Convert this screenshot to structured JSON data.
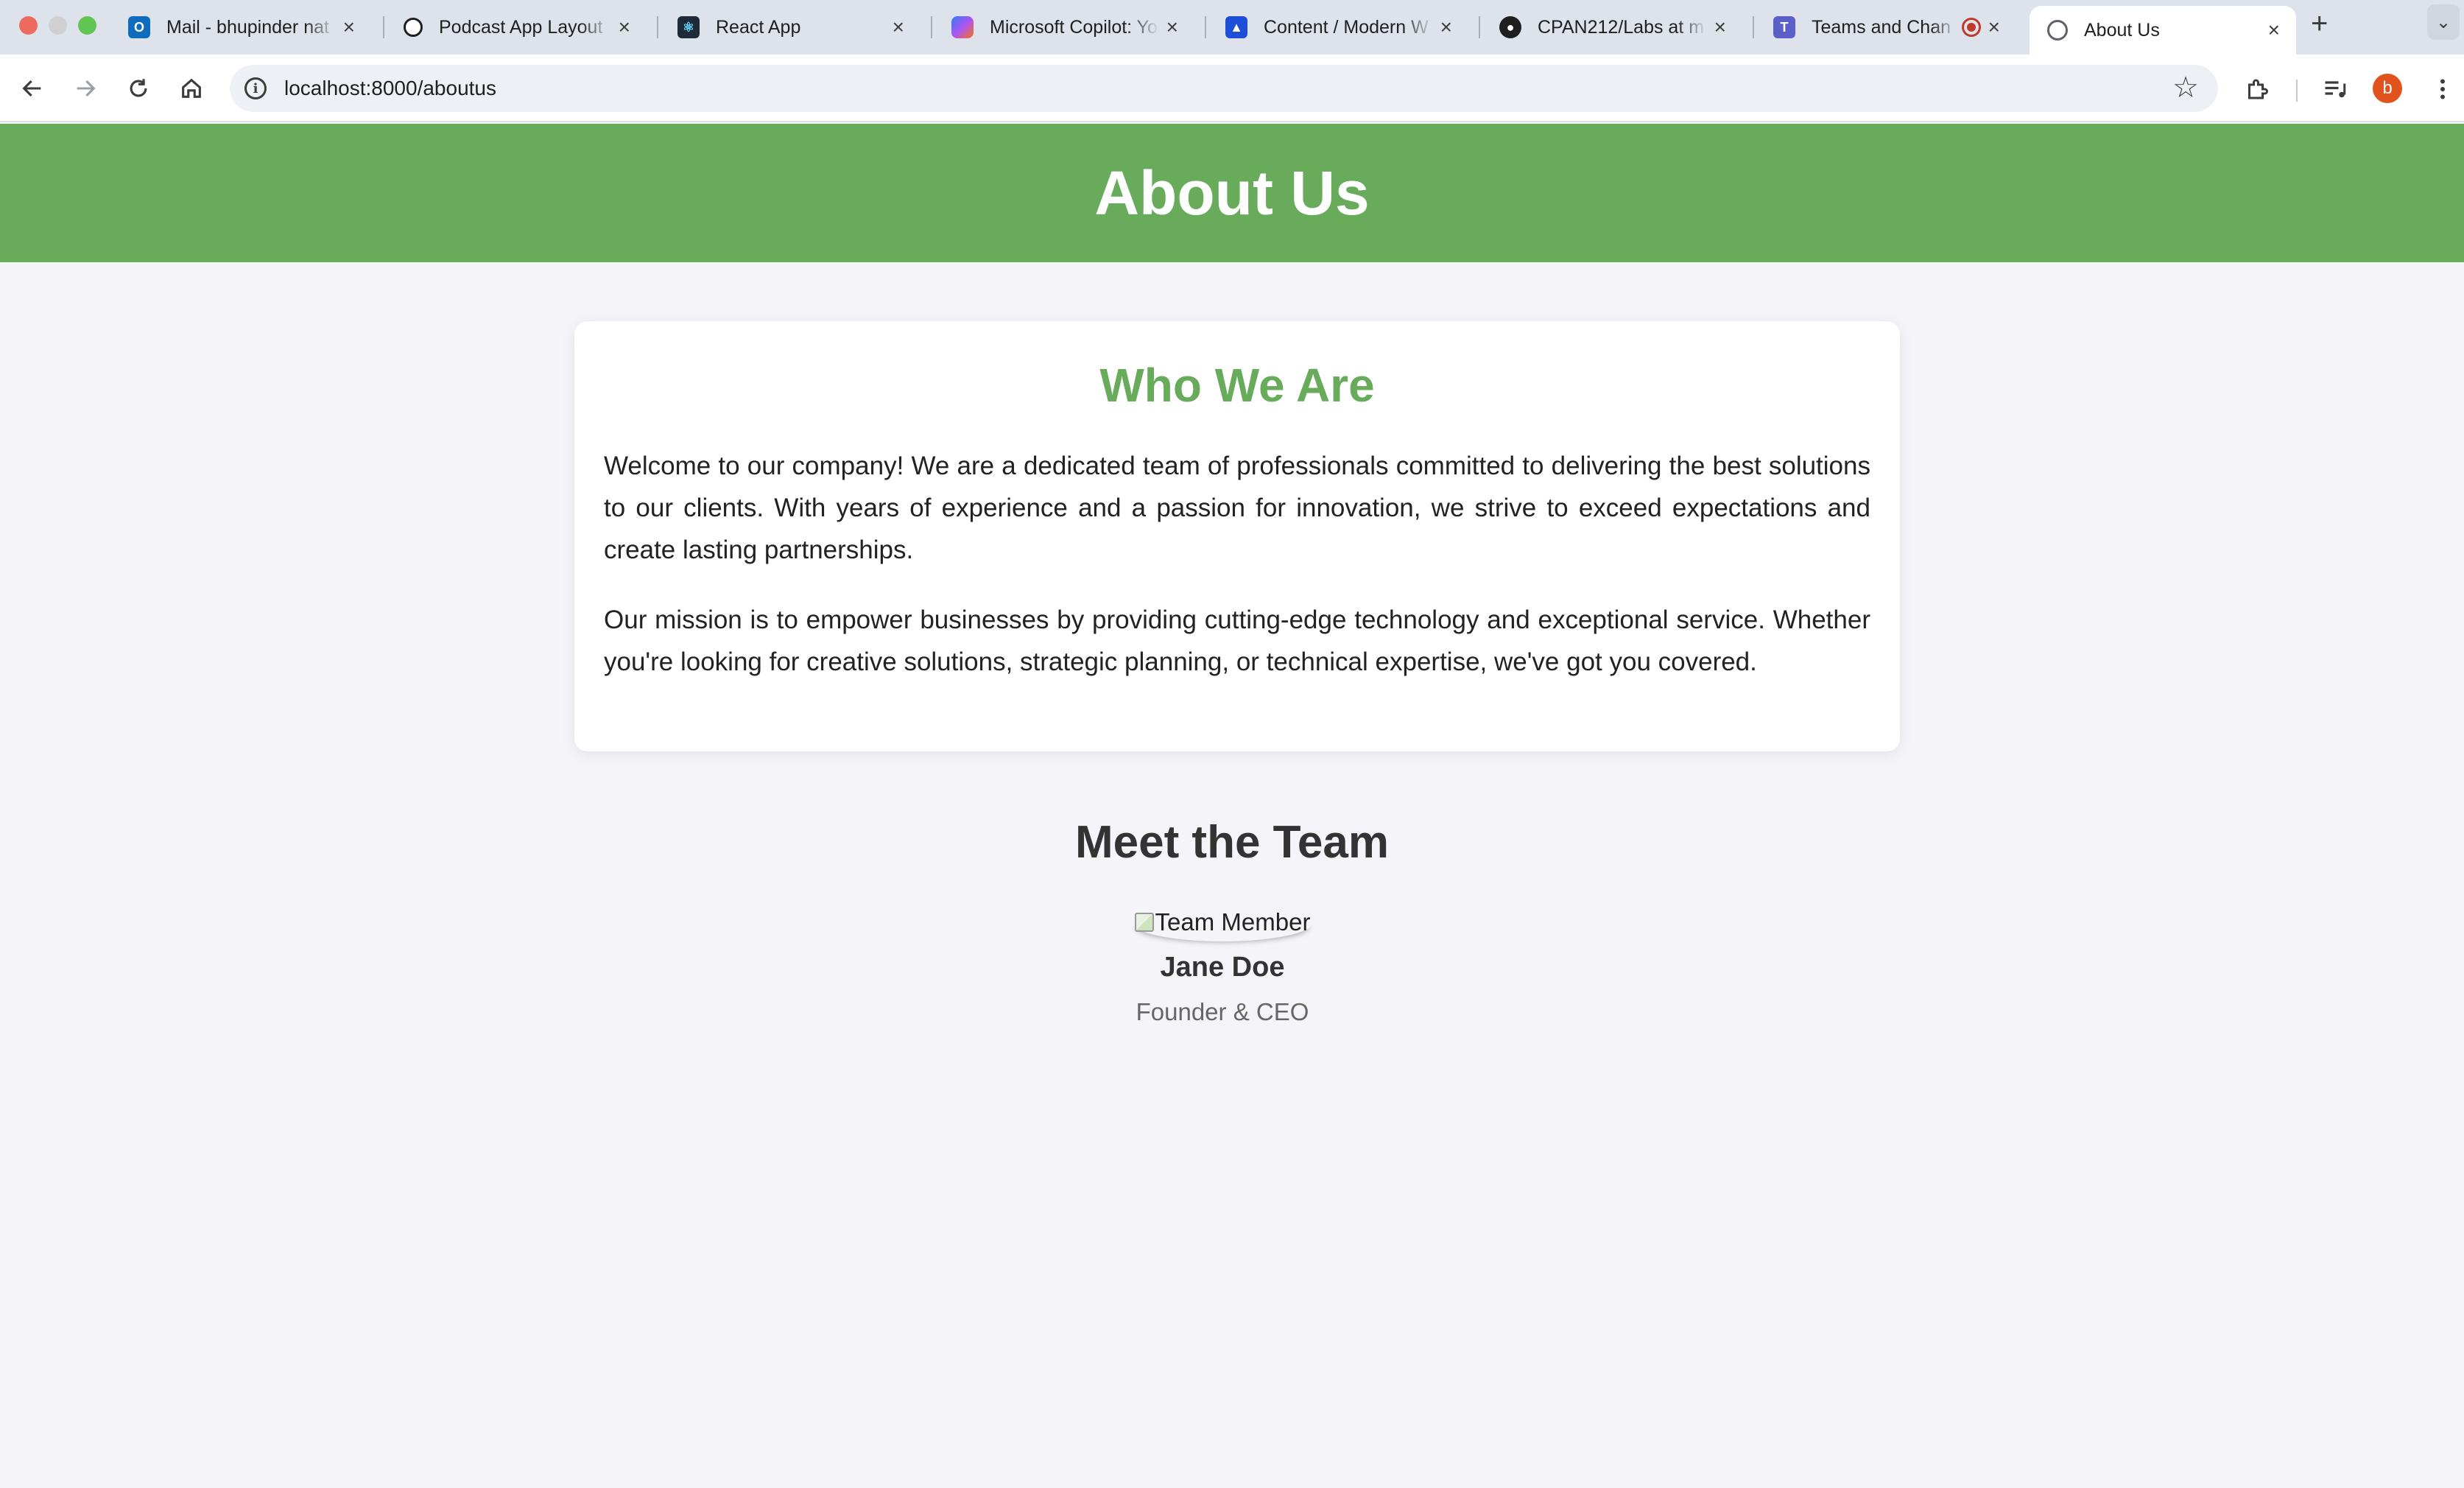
{
  "tabs": [
    {
      "label": "Mail - bhupinder nat",
      "icon": "outlook-icon",
      "color": "#0f6cbd"
    },
    {
      "label": "Podcast App Layout",
      "icon": "openai-icon",
      "color": "#1f1f1f"
    },
    {
      "label": "React App",
      "icon": "react-icon",
      "color": "#1f2937"
    },
    {
      "label": "Microsoft Copilot: Yo",
      "icon": "copilot-icon",
      "color": "#7b5cf5"
    },
    {
      "label": "Content / Modern W",
      "icon": "atlassian-icon",
      "color": "#1d4ed8"
    },
    {
      "label": "CPAN212/Labs at m",
      "icon": "github-icon",
      "color": "#1f1f1f"
    },
    {
      "label": "Teams and Chan",
      "icon": "teams-icon",
      "color": "#5b5fc7"
    },
    {
      "label": "About Us",
      "icon": "globe-icon",
      "color": "#5f6368",
      "active": true
    }
  ],
  "address_bar": {
    "url": "localhost:8000/aboutus"
  },
  "profile": {
    "initial": "b"
  },
  "page": {
    "header_title": "About Us",
    "who_we_are": {
      "heading": "Who We Are",
      "paragraph1": "Welcome to our company! We are a dedicated team of professionals committed to delivering the best solutions to our clients. With years of experience and a passion for innovation, we strive to exceed expectations and create lasting partnerships.",
      "paragraph2": "Our mission is to empower businesses by providing cutting-edge technology and exceptional service. Whether you're looking for creative solutions, strategic planning, or technical expertise, we've got you covered."
    },
    "team": {
      "heading": "Meet the Team",
      "members": [
        {
          "image_alt": "Team Member",
          "name": "Jane Doe",
          "role": "Founder & CEO"
        }
      ]
    }
  },
  "colors": {
    "accent": "#67ab5b",
    "background": "#f4f4f9"
  }
}
